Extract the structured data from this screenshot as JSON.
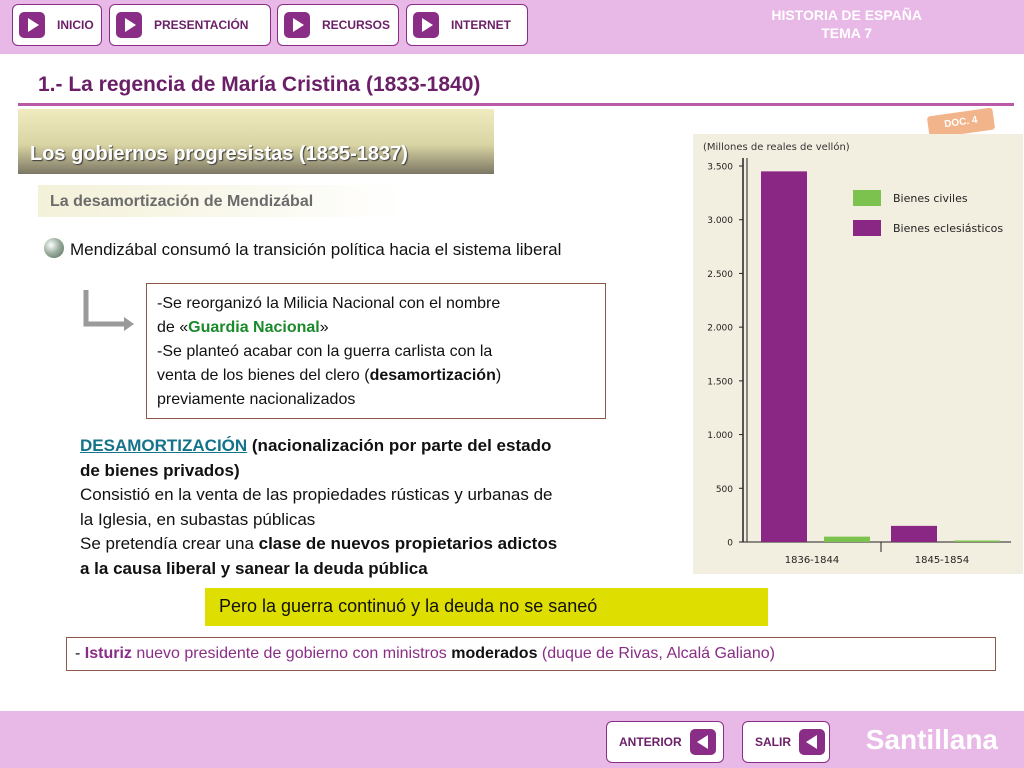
{
  "nav": {
    "items": [
      {
        "label": "INICIO"
      },
      {
        "label": "PRESENTACIÓN"
      },
      {
        "label": "RECURSOS"
      },
      {
        "label": "INTERNET"
      }
    ],
    "brand_line1": "HISTORIA DE ESPAÑA",
    "brand_line2": "TEMA 7"
  },
  "page": {
    "title": "1.- La regencia de María Cristina (1833-1840)",
    "doc_tag": "DOC. 4",
    "section": "Los gobiernos progresistas (1835-1837)",
    "subsection": "La desamortización de Mendizábal",
    "lead": "Mendizábal consumó la transición política hacia el sistema liberal"
  },
  "box": {
    "l1": "-Se reorganizó la Milicia Nacional con el nombre",
    "l2_pre": "de «",
    "l2_strong": "Guardia Nacional",
    "l2_post": "»",
    "l3": "-Se planteó acabar con la guerra carlista con la",
    "l4_pre": "venta de los bienes del clero (",
    "l4_strong": "desamortización",
    "l4_post": ")",
    "l5": "previamente nacionalizados"
  },
  "deso": {
    "head": "DESAMORTIZACIÓN",
    "def1": " (nacionalización por parte del estado",
    "def2": "de bienes privados)",
    "t1": "Consistió en la venta de las propiedades rústicas y urbanas de",
    "t2": "la Iglesia, en subastas públicas",
    "t3_pre": "Se pretendía crear una ",
    "t3_strong": "clase de nuevos propietarios adictos",
    "t4": "a la causa liberal y sanear la deuda pública"
  },
  "yellow": "Pero la guerra continuó y la deuda no se saneó",
  "isturiz": {
    "dash": "- ",
    "name": "Isturiz",
    "mid": " nuevo presidente de gobierno con ministros ",
    "strong": "moderados",
    "tail": " (duque de Rivas,  Alcalá Galiano)"
  },
  "chart_data": {
    "type": "bar",
    "title": "(Millones de reales de vellón)",
    "categories": [
      "1836-1844",
      "1845-1854"
    ],
    "series": [
      {
        "name": "Bienes eclesiásticos",
        "color": "#8a2683",
        "values": [
          3450,
          150
        ]
      },
      {
        "name": "Bienes civiles",
        "color": "#7bc24e",
        "values": [
          50,
          0
        ]
      }
    ],
    "ylim": [
      0,
      3500
    ],
    "yticks": [
      "0",
      "500",
      "1.000",
      "1.500",
      "2.000",
      "2.500",
      "3.000",
      "3.500"
    ],
    "legend": "top-right"
  },
  "footer": {
    "prev": "ANTERIOR",
    "exit": "SALIR",
    "brand": "Santillana"
  }
}
